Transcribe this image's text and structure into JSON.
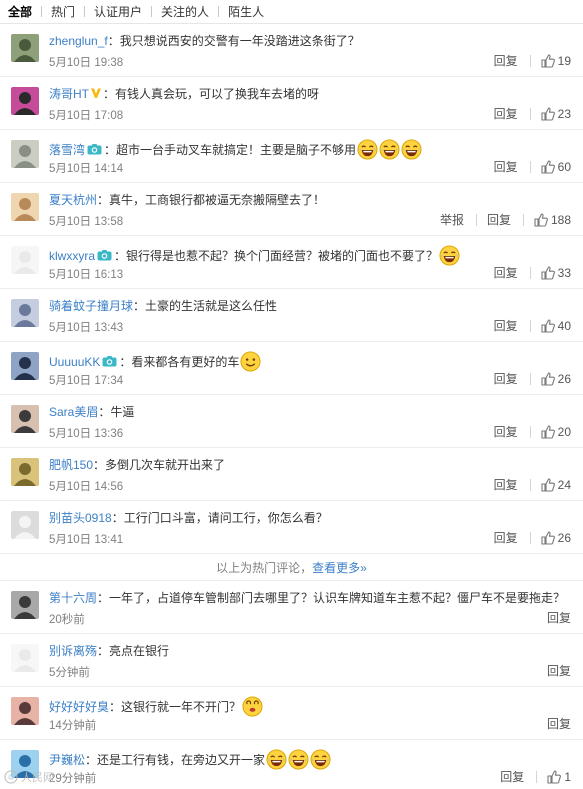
{
  "tabs": [
    "全部",
    "热门",
    "认证用户",
    "关注的人",
    "陌生人"
  ],
  "labels": {
    "reply": "回复",
    "report": "举报"
  },
  "hot_divider": {
    "text": "以上为热门评论，",
    "link": "查看更多»"
  },
  "hot_comments": [
    {
      "user": "zhenglun_f",
      "text": "：我只想说西安的交警有一年没踏进这条街了？",
      "time": "5月10日 19:38",
      "likes": "19"
    },
    {
      "user": "涛哥HT",
      "badge": "v",
      "text": "：有钱人真会玩，可以了换我车去堵的呀",
      "time": "5月10日 17:08",
      "likes": "23"
    },
    {
      "user": "落雪湾",
      "badge": "cam",
      "text": "：超市一台手动叉车就搞定！主要是脑子不够用",
      "emojis": 3,
      "time": "5月10日 14:14",
      "likes": "60"
    },
    {
      "user": "夏天杭州",
      "text": "：真牛，工商银行都被逼无奈搬隔壁去了！",
      "time": "5月10日 13:58",
      "likes": "188",
      "report": true
    },
    {
      "user": "klwxxyra",
      "badge": "cam",
      "text": "：银行得是也惹不起？换个门面经营？被堵的门面也不要了？",
      "emojis": 1,
      "time": "5月10日 16:13",
      "likes": "33"
    },
    {
      "user": "骑着蚊子撞月球",
      "text": "：土豪的生活就是这么任性",
      "time": "5月10日 13:43",
      "likes": "40"
    },
    {
      "user": "UuuuuKK",
      "badge": "cam",
      "text": "：看来都各有更好的车",
      "emojis": 1,
      "emoji_kind": "smile",
      "time": "5月10日 17:34",
      "likes": "26"
    },
    {
      "user": "Sara美眉",
      "text": "：牛逼",
      "time": "5月10日 13:36",
      "likes": "20"
    },
    {
      "user": "肥帆150",
      "text": "：多倒几次车就开出来了",
      "time": "5月10日 14:56",
      "likes": "24"
    },
    {
      "user": "别苗头0918",
      "text": "：工行门口斗富，请问工行，你怎么看？",
      "time": "5月10日 13:41",
      "likes": "26"
    }
  ],
  "recent_comments": [
    {
      "user": "第十六周",
      "text": "：一年了，占道停车管制部门去哪里了？认识车牌知道车主惹不起？僵尸车不是要拖走？",
      "time": "20秒前"
    },
    {
      "user": "别诉离殇",
      "text": "：亮点在银行",
      "time": "5分钟前"
    },
    {
      "user": "好好好好臭",
      "text": "：这银行就一年不开门？",
      "emojis": 1,
      "emoji_kind": "dizzy",
      "time": "14分钟前"
    },
    {
      "user": "尹巍松",
      "text": "：还是工行有钱，在旁边又开一家",
      "emojis": 3,
      "time": "29分钟前",
      "likes": "1"
    }
  ],
  "watermark": "人民网",
  "colors": {
    "link": "#3d80c6",
    "meta": "#808080",
    "divider": "#ececec"
  }
}
